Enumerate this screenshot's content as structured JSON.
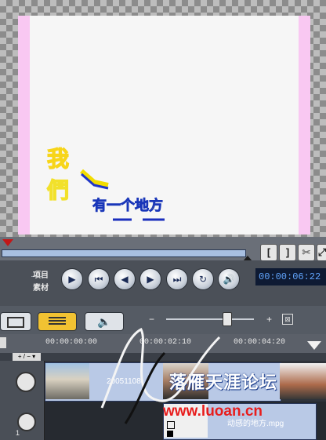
{
  "preview": {
    "overlay_title_chars": "我們有一个地方"
  },
  "scrubber": {
    "mark_in_label": "[",
    "mark_out_label": "]",
    "cut_icon": "scissors-icon",
    "extra_icon": "expand-icon"
  },
  "controls": {
    "project_label": "项目",
    "clip_label": "素材",
    "buttons": [
      {
        "name": "play-button",
        "icon": "▶"
      },
      {
        "name": "home-button",
        "icon": "⏮"
      },
      {
        "name": "prev-frame-button",
        "icon": "◀"
      },
      {
        "name": "next-frame-button",
        "icon": "▶"
      },
      {
        "name": "end-button",
        "icon": "⏭"
      },
      {
        "name": "repeat-button",
        "icon": "↻"
      },
      {
        "name": "volume-button",
        "icon": "🔊"
      }
    ],
    "timecode": "00:00:06:22"
  },
  "toolbar": {
    "views": [
      "storyboard-view",
      "timeline-view",
      "audio-view"
    ],
    "zoom_out": "−",
    "zoom_in": "+",
    "fit_icon": "fit-project-icon"
  },
  "timeline": {
    "ruler_labels": [
      "00:00:00:00",
      "00:00:02:10",
      "00:00:04:20"
    ],
    "video_clip_name": "20051108",
    "overlay_clip_name": "动感的地方.mpg",
    "watermark_text": "www.luoan.cn",
    "watermark_banner": "落雁天涯论坛",
    "track_number": "1"
  },
  "colors": {
    "timecode_bg": "#0e1a33",
    "timecode_fg": "#62a6ff",
    "accent_active": "#f1c232",
    "watermark_red": "#e81d1d"
  }
}
